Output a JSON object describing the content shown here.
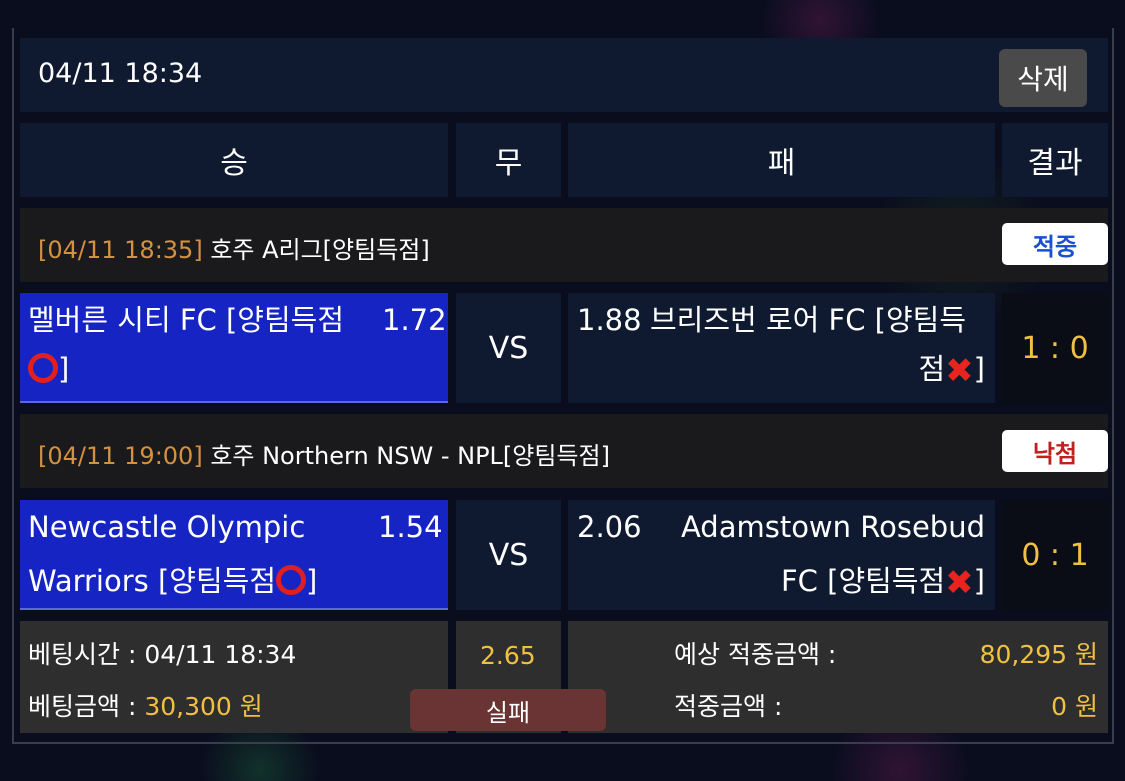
{
  "header": {
    "datetime": "04/11 18:34",
    "delete_label": "삭제"
  },
  "columns": {
    "win": "승",
    "draw": "무",
    "lose": "패",
    "result": "결과"
  },
  "matches": [
    {
      "league_time": "[04/11 18:35]",
      "league_name": " 호주 A리그[양팀득점]",
      "status": "적중",
      "status_color": "#1a4fd0",
      "home_line1": "멜버른 시티 FC [양팀득점",
      "home_line2": "]",
      "home_odds": "1.72",
      "vs": "VS",
      "away_odds": "1.88",
      "away_line1": "브리즈번 로어 FC [양팀득",
      "away_line2": "점",
      "away_line2_tail": "]",
      "score": "1 : 0"
    },
    {
      "league_time": "[04/11 19:00]",
      "league_name": " 호주 Northern NSW - NPL[양팀득점]",
      "status": "낙첨",
      "status_color": "#c02020",
      "home_line1": "Newcastle Olympic",
      "home_line2": "Warriors [양팀득점",
      "home_line2_tail": "]",
      "home_odds": "1.54",
      "vs": "VS",
      "away_odds": "2.06",
      "away_line1": "Adamstown Rosebud",
      "away_line2": "FC [양팀득점",
      "away_line2_tail": "]",
      "score": "0 : 1"
    }
  ],
  "footer": {
    "bet_time_label": "베팅시간 : ",
    "bet_time_value": "04/11 18:34",
    "bet_amount_label": "베팅금액 : ",
    "bet_amount_value": "30,300 원",
    "total_odds": "2.65",
    "fail_label": "실패",
    "expected_label": "예상 적중금액 :",
    "expected_value": "80,295 원",
    "win_amount_label": "적중금액 :",
    "win_amount_value": "0 원"
  },
  "icons": {
    "hit": "red-circle-icon",
    "miss": "red-x-icon"
  },
  "colors": {
    "home_bg": "#1524c2",
    "accent_yellow": "#f0c040",
    "time_orange": "#d4913f"
  }
}
